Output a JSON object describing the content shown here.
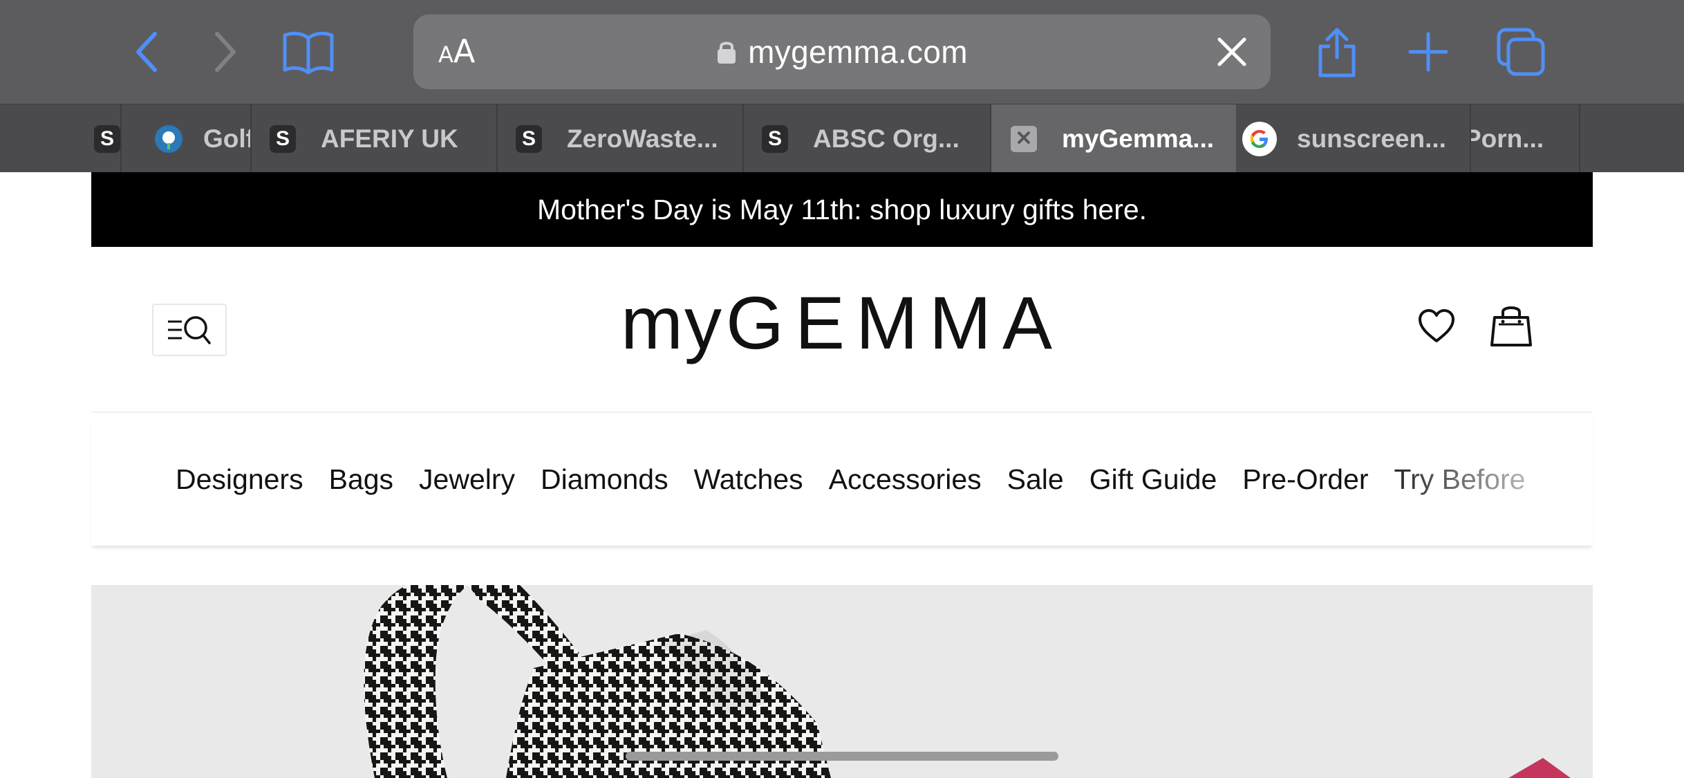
{
  "browser": {
    "url": "mygemma.com",
    "reader_small": "A",
    "reader_big": "A",
    "colors": {
      "accent": "#3b82f6",
      "toolbar": "#5c5c5e",
      "tab_bg": "#4b4b4d"
    },
    "icons": [
      "back-icon",
      "forward-icon",
      "bookmarks-icon",
      "lock-icon",
      "clear-icon",
      "share-icon",
      "new-tab-icon",
      "tabs-icon"
    ]
  },
  "tabs": [
    {
      "fav": "S",
      "title": ""
    },
    {
      "fav": "",
      "title": "Golf"
    },
    {
      "fav": "S",
      "title": "AFERIY UK"
    },
    {
      "fav": "S",
      "title": "ZeroWaste..."
    },
    {
      "fav": "S",
      "title": "ABSC Org..."
    },
    {
      "fav": "✕",
      "title": "myGemma..."
    },
    {
      "fav": "",
      "title": "sunscreen..."
    },
    {
      "fav": "",
      "title": "Porn..."
    }
  ],
  "promo": {
    "text": "Mother's Day is May 11th: shop luxury gifts here."
  },
  "logo": {
    "my": "my",
    "brand": "GEMMA"
  },
  "nav": [
    "Designers",
    "Bags",
    "Jewelry",
    "Diamonds",
    "Watches",
    "Accessories",
    "Sale",
    "Gift Guide",
    "Pre-Order",
    "Try Before"
  ]
}
